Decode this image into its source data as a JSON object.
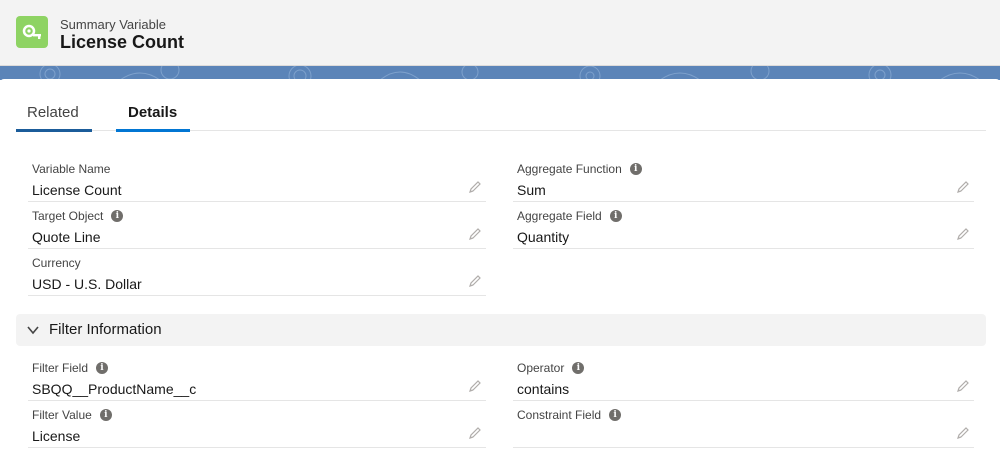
{
  "header": {
    "subtitle": "Summary Variable",
    "title": "License Count",
    "icon": "summary-variable-icon",
    "icon_color": "#8ed363"
  },
  "tabs": [
    {
      "label": "Related",
      "active": false
    },
    {
      "label": "Details",
      "active": true
    }
  ],
  "details": {
    "variable_name": {
      "label": "Variable Name",
      "value": "License Count"
    },
    "aggregate_function": {
      "label": "Aggregate Function",
      "value": "Sum"
    },
    "target_object": {
      "label": "Target Object",
      "value": "Quote Line"
    },
    "aggregate_field": {
      "label": "Aggregate Field",
      "value": "Quantity"
    },
    "currency": {
      "label": "Currency",
      "value": "USD - U.S. Dollar"
    }
  },
  "filter_section": {
    "title": "Filter Information",
    "filter_field": {
      "label": "Filter Field",
      "value": "SBQQ__ProductName__c"
    },
    "operator": {
      "label": "Operator",
      "value": "contains"
    },
    "filter_value": {
      "label": "Filter Value",
      "value": "License"
    },
    "constraint_field": {
      "label": "Constraint Field",
      "value": ""
    }
  },
  "colors": {
    "accent": "#0176d3",
    "banner": "#5b84b8"
  }
}
